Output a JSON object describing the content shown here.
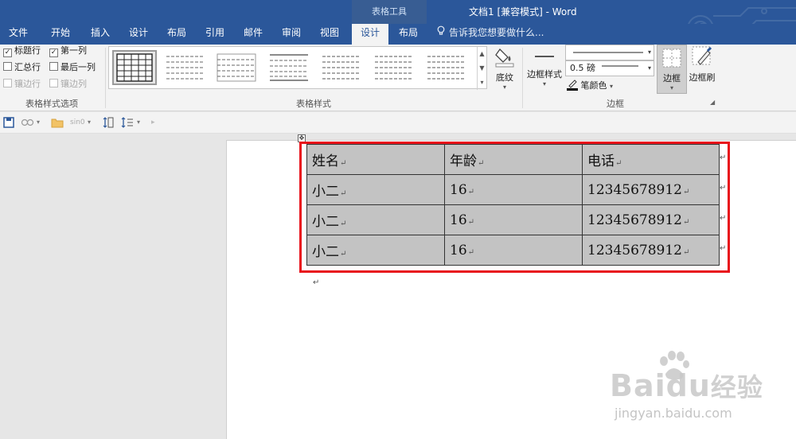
{
  "titlebar": {
    "context_tab": "表格工具",
    "doc_title": "文档1 [兼容模式] - Word"
  },
  "tabs": [
    "文件",
    "开始",
    "插入",
    "设计",
    "布局",
    "引用",
    "邮件",
    "审阅",
    "视图",
    "设计",
    "布局"
  ],
  "active_tab_index": 9,
  "tellme": {
    "placeholder": "告诉我您想要做什么..."
  },
  "ribbon": {
    "style_options": {
      "label": "表格样式选项",
      "checkboxes": [
        {
          "label": "标题行",
          "checked": true,
          "enabled": true
        },
        {
          "label": "第一列",
          "checked": true,
          "enabled": true
        },
        {
          "label": "汇总行",
          "checked": false,
          "enabled": true
        },
        {
          "label": "最后一列",
          "checked": false,
          "enabled": true
        },
        {
          "label": "镶边行",
          "checked": false,
          "enabled": false
        },
        {
          "label": "镶边列",
          "checked": false,
          "enabled": false
        }
      ]
    },
    "table_styles": {
      "label": "表格样式",
      "shading_label": "底纹"
    },
    "borders": {
      "label": "边框",
      "border_styles_label": "边框样式",
      "weight_value": "0.5 磅",
      "pen_color_label": "笔颜色",
      "borders_label": "边框",
      "border_painter_label": "边框刷"
    }
  },
  "qat": {
    "font_hint": "sin0"
  },
  "table": {
    "rows": [
      [
        "姓名",
        "年龄",
        "电话"
      ],
      [
        "小二",
        "16",
        "12345678912"
      ],
      [
        "小二",
        "16",
        "12345678912"
      ],
      [
        "小二",
        "16",
        "12345678912"
      ]
    ],
    "para_mark": "↵"
  },
  "watermark": {
    "brand": "Bai",
    "brand2": "du",
    "brand_cn": "经验",
    "url": "jingyan.baidu.com"
  },
  "colors": {
    "title_bar": "#2b579a",
    "highlight": "#e8101a",
    "table_fill": "#c3c3c3"
  }
}
